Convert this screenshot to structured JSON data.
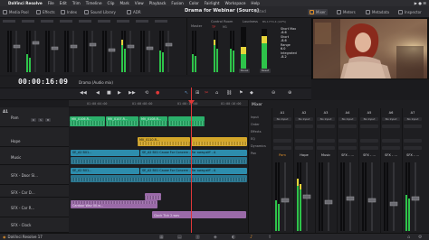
{
  "menubar": {
    "items": [
      "DaVinci Resolve",
      "File",
      "Edit",
      "Trim",
      "Timeline",
      "Clip",
      "Mark",
      "View",
      "Playback",
      "Fusion",
      "Color",
      "Fairlight",
      "Workspace",
      "Help"
    ],
    "right": "▶ ● ☰"
  },
  "toolbar": {
    "media_pool": "Media Pool",
    "effects": "Effects",
    "index": "Index",
    "sound_library": "Sound Library",
    "adr": "ADR",
    "title": "Drama for Webinar (Source)",
    "edited": "Edited",
    "mixer": "Mixer",
    "meters": "Meters",
    "metadata": "Metadata",
    "inspector": "Inspector"
  },
  "meters_panel": {
    "master_label": "Master",
    "control_room_label": "Control Room",
    "loudness_label": "Loudness",
    "loudness_std": "BS.1770-4 (LUFS)",
    "short_max": "Short Max",
    "short": "Short",
    "range": "Range",
    "integrated": "Integrated",
    "short_max_value": "-6.6",
    "short_value": "-8.6",
    "range_value": "6.0",
    "integrated_value": "-8.2",
    "pause": "Pause",
    "reset": "Reset",
    "tp_label": "TP",
    "m1": "M1"
  },
  "timeline": {
    "timecode": "00:00:16:09",
    "name": "Drama (Audio mix)",
    "ruler": [
      "01:00:04:00",
      "01:00:08:00",
      "01:00:12:00",
      "01:00:16:00"
    ]
  },
  "tracks": [
    {
      "id": "A1",
      "name": "Pam",
      "clips": [
        {
          "label": "MV_0106.R...",
          "color": "green"
        },
        {
          "label": "MV_0107.R...",
          "color": "green"
        },
        {
          "label": "MV_0108.R...",
          "color": "green"
        },
        {
          "label": "",
          "color": "green"
        }
      ]
    },
    {
      "id": "",
      "name": "Hope",
      "clips": [
        {
          "label": "MV_0110.R...",
          "color": "yellow"
        },
        {
          "label": "",
          "color": "yellow"
        }
      ]
    },
    {
      "id": "",
      "name": "Music",
      "clips": [
        {
          "label": "SE_A2 B01...",
          "color": "blue"
        },
        {
          "label": "SE_A2 B01 Cause For Concern - Far away.aiff - A",
          "color": "blue"
        }
      ]
    },
    {
      "id": "",
      "name": "SFX - Door Sl...",
      "clips": [
        {
          "label": "SE_A2 B01...",
          "color": "blue"
        },
        {
          "label": "SE_A2 B01 Cause For Concern - Far away.aiff - A",
          "color": "blue"
        }
      ]
    },
    {
      "id": "",
      "name": "SFX - Car D...",
      "clips": []
    },
    {
      "id": "",
      "name": "SFX - Car R...",
      "clips": [
        {
          "label": "Cardoor Wav 00.w...",
          "color": "purple"
        },
        {
          "label": "",
          "color": "purple"
        }
      ]
    },
    {
      "id": "",
      "name": "SFX - Clock",
      "clips": [
        {
          "label": "Clock Tick 2.wav",
          "color": "purple"
        }
      ]
    }
  ],
  "mixer": {
    "title": "Mixer",
    "row_labels": [
      "Input",
      "Order",
      "Effects",
      "EQ",
      "Dynamics",
      "Pan"
    ],
    "channels": [
      {
        "id": "A1",
        "input": "No Input",
        "name": "Pam"
      },
      {
        "id": "A2",
        "input": "No Input",
        "name": "Hope"
      },
      {
        "id": "A3",
        "input": "No Input",
        "name": "Music"
      },
      {
        "id": "A4",
        "input": "No Input",
        "name": "SFX - ..."
      },
      {
        "id": "A5",
        "input": "No Input",
        "name": "SFX - ..."
      },
      {
        "id": "A6",
        "input": "No Input",
        "name": "SFX - ..."
      },
      {
        "id": "A7",
        "input": "No Input",
        "name": "SFX - ..."
      },
      {
        "id": "Bus1",
        "input": "",
        "name": "Bus 1"
      }
    ]
  },
  "statusbar": {
    "app_name": "DaVinci Resolve 17"
  }
}
